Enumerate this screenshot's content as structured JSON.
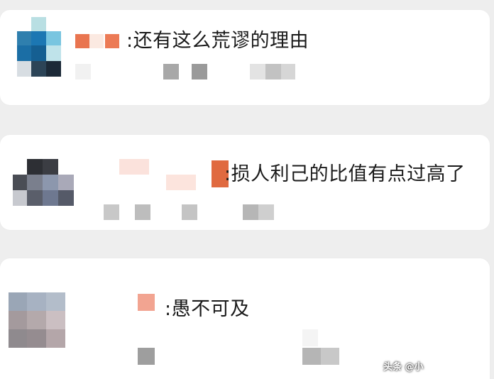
{
  "comments": [
    {
      "text": ":还有这么荒谬的理由"
    },
    {
      "text": ":损人利己的比值有点过高了"
    },
    {
      "text": ":愚不可及"
    }
  ],
  "watermark": {
    "text": "头条 @小"
  },
  "colors": {
    "background": "#eeeeee",
    "card": "#ffffff",
    "text": "#1a1a1a"
  }
}
